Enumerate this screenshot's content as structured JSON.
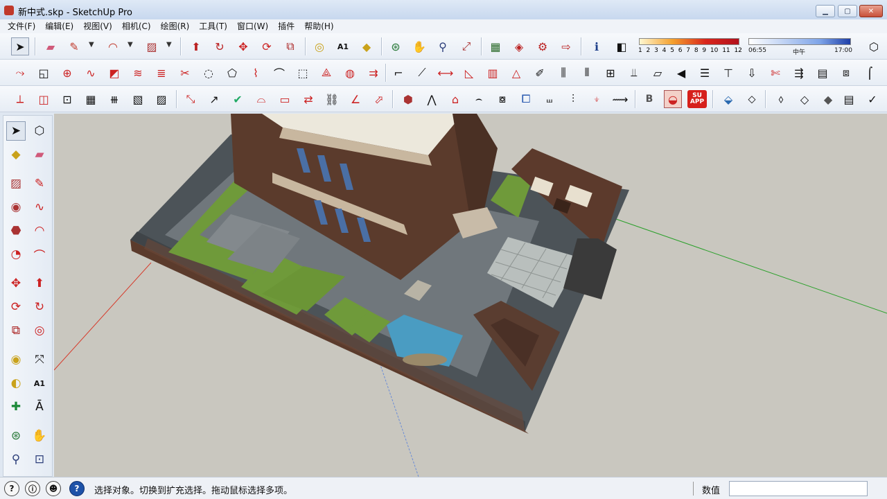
{
  "window": {
    "title": "新中式.skp - SketchUp Pro",
    "minimize_icon": "minimize-icon",
    "maximize_icon": "maximize-icon",
    "close_icon": "close-icon"
  },
  "menu": [
    "文件(F)",
    "编辑(E)",
    "视图(V)",
    "相机(C)",
    "绘图(R)",
    "工具(T)",
    "窗口(W)",
    "插件",
    "帮助(H)"
  ],
  "shadow": {
    "months": [
      "1",
      "2",
      "3",
      "4",
      "5",
      "6",
      "7",
      "8",
      "9",
      "10",
      "11",
      "12"
    ],
    "time_start": "06:55",
    "time_mid": "中午",
    "time_end": "17:00"
  },
  "toolbar3": {
    "su_app_label": "SU APP",
    "b_label": "B"
  },
  "status": {
    "text": "选择对象。切换到扩充选择。拖动鼠标选择多项。",
    "measure_label": "数值",
    "measure_value": ""
  },
  "colors": {
    "grass": "#6f9a3a",
    "wall": "#5b3b2c",
    "pool": "#4a9cc2",
    "axis_red": "#d63a2a",
    "axis_green": "#2aa02a",
    "axis_blue": "#6a8cd6"
  }
}
